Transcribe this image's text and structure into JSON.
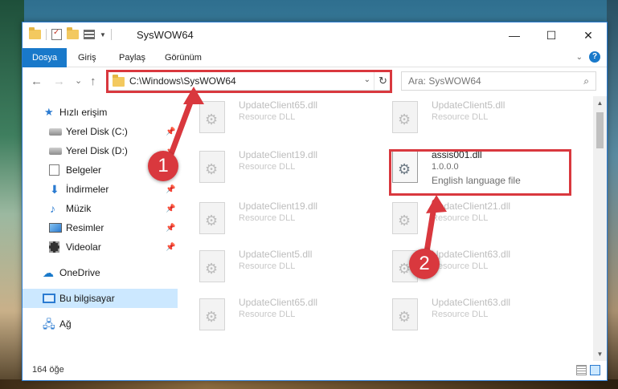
{
  "window": {
    "title": "SysWOW64",
    "controls": {
      "minimize": "—",
      "maximize": "☐",
      "close": "✕"
    }
  },
  "ribbon": {
    "tabs": [
      "Dosya",
      "Giriş",
      "Paylaş",
      "Görünüm"
    ],
    "active_tab": "Dosya",
    "help_glyph": "?"
  },
  "navigation": {
    "back": "←",
    "forward": "→",
    "recent": "⌄",
    "up": "↑",
    "address": "C:\\Windows\\SysWOW64",
    "search_placeholder": "Ara: SysWOW64"
  },
  "sidebar": {
    "items": [
      {
        "label": "Hızlı erişim",
        "icon": "star-icon",
        "pinned": false
      },
      {
        "label": "Yerel Disk (C:)",
        "icon": "drive-icon",
        "pinned": true
      },
      {
        "label": "Yerel Disk (D:)",
        "icon": "drive-icon",
        "pinned": true
      },
      {
        "label": "Belgeler",
        "icon": "documents-icon",
        "pinned": true
      },
      {
        "label": "İndirmeler",
        "icon": "downloads-icon",
        "pinned": true
      },
      {
        "label": "Müzik",
        "icon": "music-icon",
        "pinned": true
      },
      {
        "label": "Resimler",
        "icon": "pictures-icon",
        "pinned": true
      },
      {
        "label": "Videolar",
        "icon": "videos-icon",
        "pinned": true
      },
      {
        "label": "OneDrive",
        "icon": "onedrive-icon",
        "pinned": false
      },
      {
        "label": "Bu bilgisayar",
        "icon": "this-pc-icon",
        "pinned": false,
        "selected": true
      },
      {
        "label": "Ağ",
        "icon": "network-icon",
        "pinned": false
      }
    ]
  },
  "files": [
    {
      "name": "UpdateClient65.dll",
      "desc": "Resource DLL"
    },
    {
      "name": "UpdateClient5.dll",
      "desc": "Resource DLL"
    },
    {
      "name": "UpdateClient19.dll",
      "desc": "Resource DLL"
    },
    {
      "name": "assis001.dll",
      "desc": "1.0.0.0",
      "desc2": "English language file",
      "highlighted": true
    },
    {
      "name": "UpdateClient19.dll",
      "desc": "Resource DLL"
    },
    {
      "name": "UpdateClient21.dll",
      "desc": "Resource DLL"
    },
    {
      "name": "UpdateClient5.dll",
      "desc": "Resource DLL"
    },
    {
      "name": "UpdateClient63.dll",
      "desc": "Resource DLL"
    },
    {
      "name": "UpdateClient65.dll",
      "desc": "Resource DLL"
    },
    {
      "name": "UpdateClient63.dll",
      "desc": "Resource DLL"
    }
  ],
  "status": {
    "item_count": "164 öğe"
  },
  "annotations": {
    "step1": "1",
    "step2": "2",
    "color": "#d9383e"
  }
}
